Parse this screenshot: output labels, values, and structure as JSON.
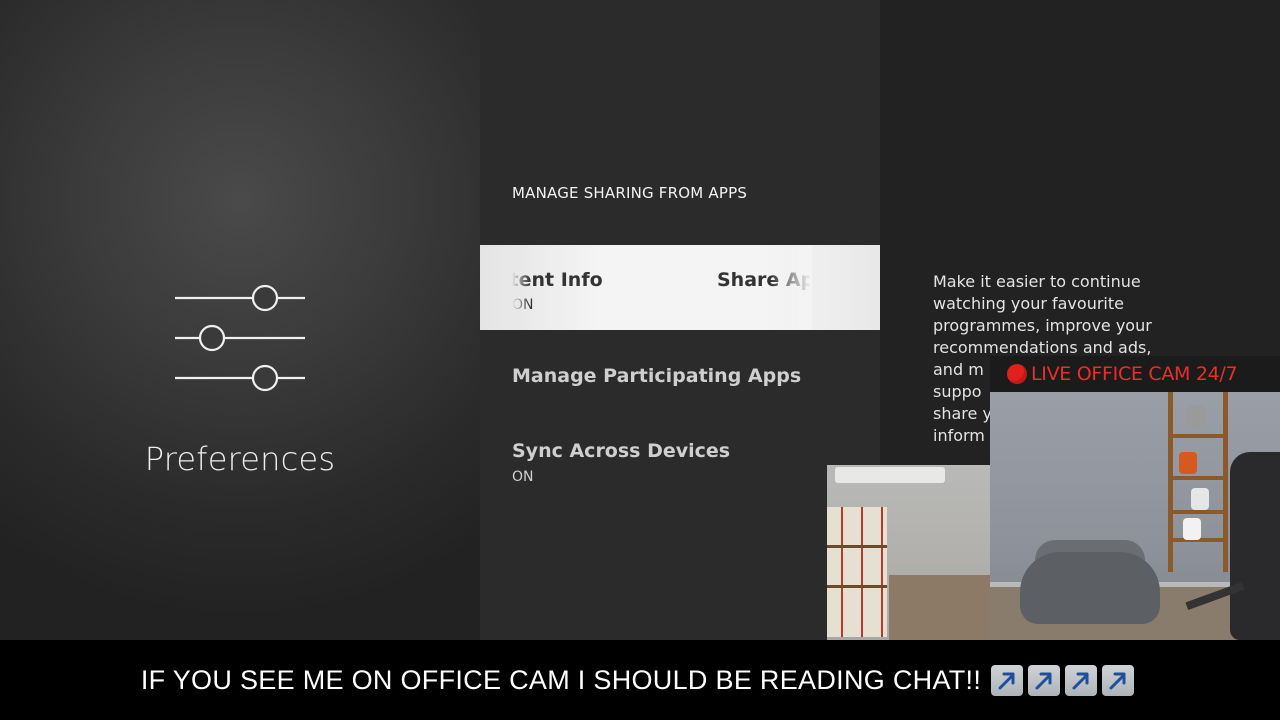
{
  "left": {
    "title": "Preferences",
    "icon": "sliders-icon"
  },
  "middle": {
    "header": "MANAGE SHARING FROM APPS",
    "selected": {
      "items": [
        {
          "title": "ntent Info",
          "value": "ON"
        },
        {
          "title": "Share Ap",
          "value": ""
        }
      ]
    },
    "rows": [
      {
        "title": "Manage Participating Apps",
        "value": ""
      },
      {
        "title": "Sync Across Devices",
        "value": "ON"
      }
    ]
  },
  "right": {
    "description_lines": [
      "Make it easier to continue",
      "watching your favourite",
      "programmes, improve your",
      "recommendations and ads,",
      "and m",
      "suppo",
      "share y",
      "inform"
    ]
  },
  "overlay": {
    "live_badge": "LIVE OFFICE CAM 24/7",
    "live_color": "#e8302a",
    "banner": "IF YOU SEE ME ON OFFICE CAM I SHOULD BE READING CHAT!!",
    "arrow_icon": "up-right-arrow-icon",
    "arrow_count": 4
  }
}
